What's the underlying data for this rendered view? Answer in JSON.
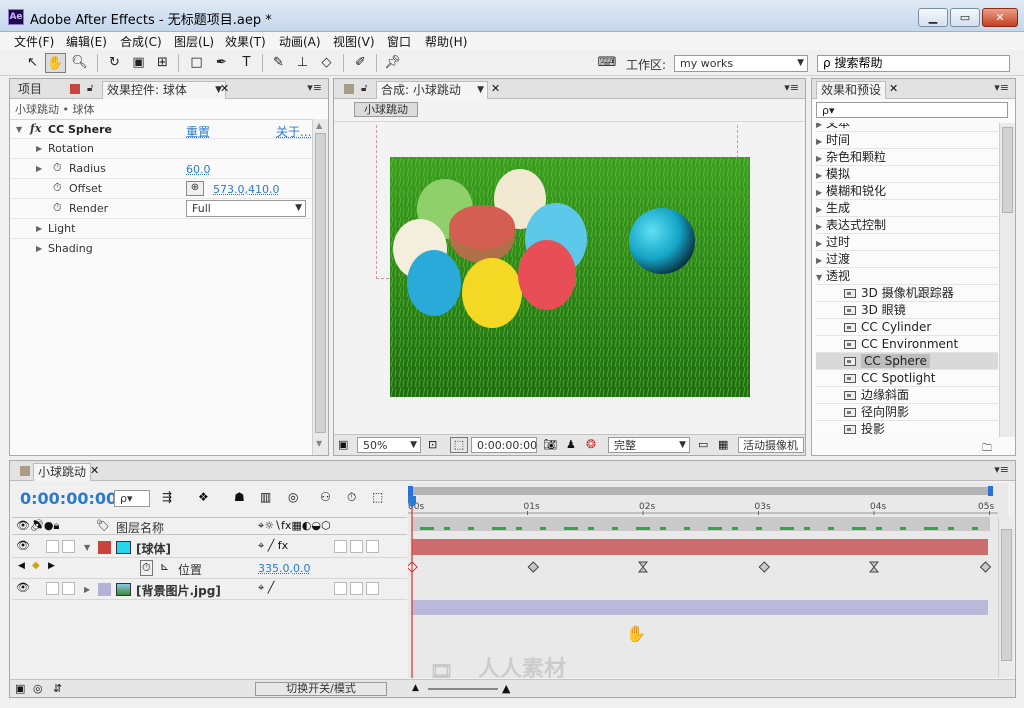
{
  "window": {
    "app_icon": "Ae",
    "title": "Adobe After Effects - 无标题项目.aep *",
    "minimize": "▭",
    "maximize": "▭",
    "close": "✕"
  },
  "menu": [
    "文件(F)",
    "编辑(E)",
    "合成(C)",
    "图层(L)",
    "效果(T)",
    "动画(A)",
    "视图(V)",
    "窗口",
    "帮助(H)"
  ],
  "toolbar": {
    "workspace_label": "工作区:",
    "workspace_value": "my works",
    "search_help": "搜索帮助"
  },
  "left_panel": {
    "tab_project": "项目",
    "tab_effects": "效果控件: 球体",
    "breadcrumb": "小球跳动 • 球体",
    "effect_name": "CC Sphere",
    "reset": "重置",
    "about": "关于...",
    "props": [
      {
        "name": "Rotation",
        "value": ""
      },
      {
        "name": "Radius",
        "value": "60.0"
      },
      {
        "name": "Offset",
        "value": "573.0,410.0"
      },
      {
        "name": "Render",
        "value": "Full"
      },
      {
        "name": "Light",
        "value": ""
      },
      {
        "name": "Shading",
        "value": ""
      }
    ]
  },
  "comp_panel": {
    "tab": "合成: 小球跳动",
    "comp_button": "小球跳动",
    "zoom": "50%",
    "timecode": "0:00:00:00",
    "resolution": "完整",
    "camera": "活动摄像机"
  },
  "effects_panel": {
    "tab": "效果和预设",
    "search_placeholder": "ρ▾",
    "categories": [
      "文本",
      "时间",
      "杂色和颗粒",
      "模拟",
      "模糊和锐化",
      "生成",
      "表达式控制",
      "过时",
      "过渡",
      "透视"
    ],
    "items": [
      "3D 摄像机跟踪器",
      "3D 眼镜",
      "CC Cylinder",
      "CC Environment",
      "CC Sphere",
      "CC Spotlight",
      "边缘斜面",
      "径向阴影",
      "投影"
    ],
    "selected_item": "CC Sphere"
  },
  "timeline": {
    "tab": "小球跳动",
    "timecode": "0:00:00:00",
    "search": "ρ▾",
    "col_layer_name": "图层名称",
    "ruler": [
      "00s",
      "01s",
      "02s",
      "03s",
      "04s",
      "05s"
    ],
    "layers": [
      {
        "name": "[球体]",
        "color": "#c8453e"
      },
      {
        "name": "位置",
        "value": "335.0,0.0"
      },
      {
        "name": "[背景图片.jpg]",
        "color": "#b2b2d8"
      }
    ],
    "toggle_modes": "切换开关/模式",
    "keyframes": [
      0,
      1.05,
      2.0,
      3.05,
      4.0,
      5.0
    ]
  },
  "watermark": "人人素材"
}
